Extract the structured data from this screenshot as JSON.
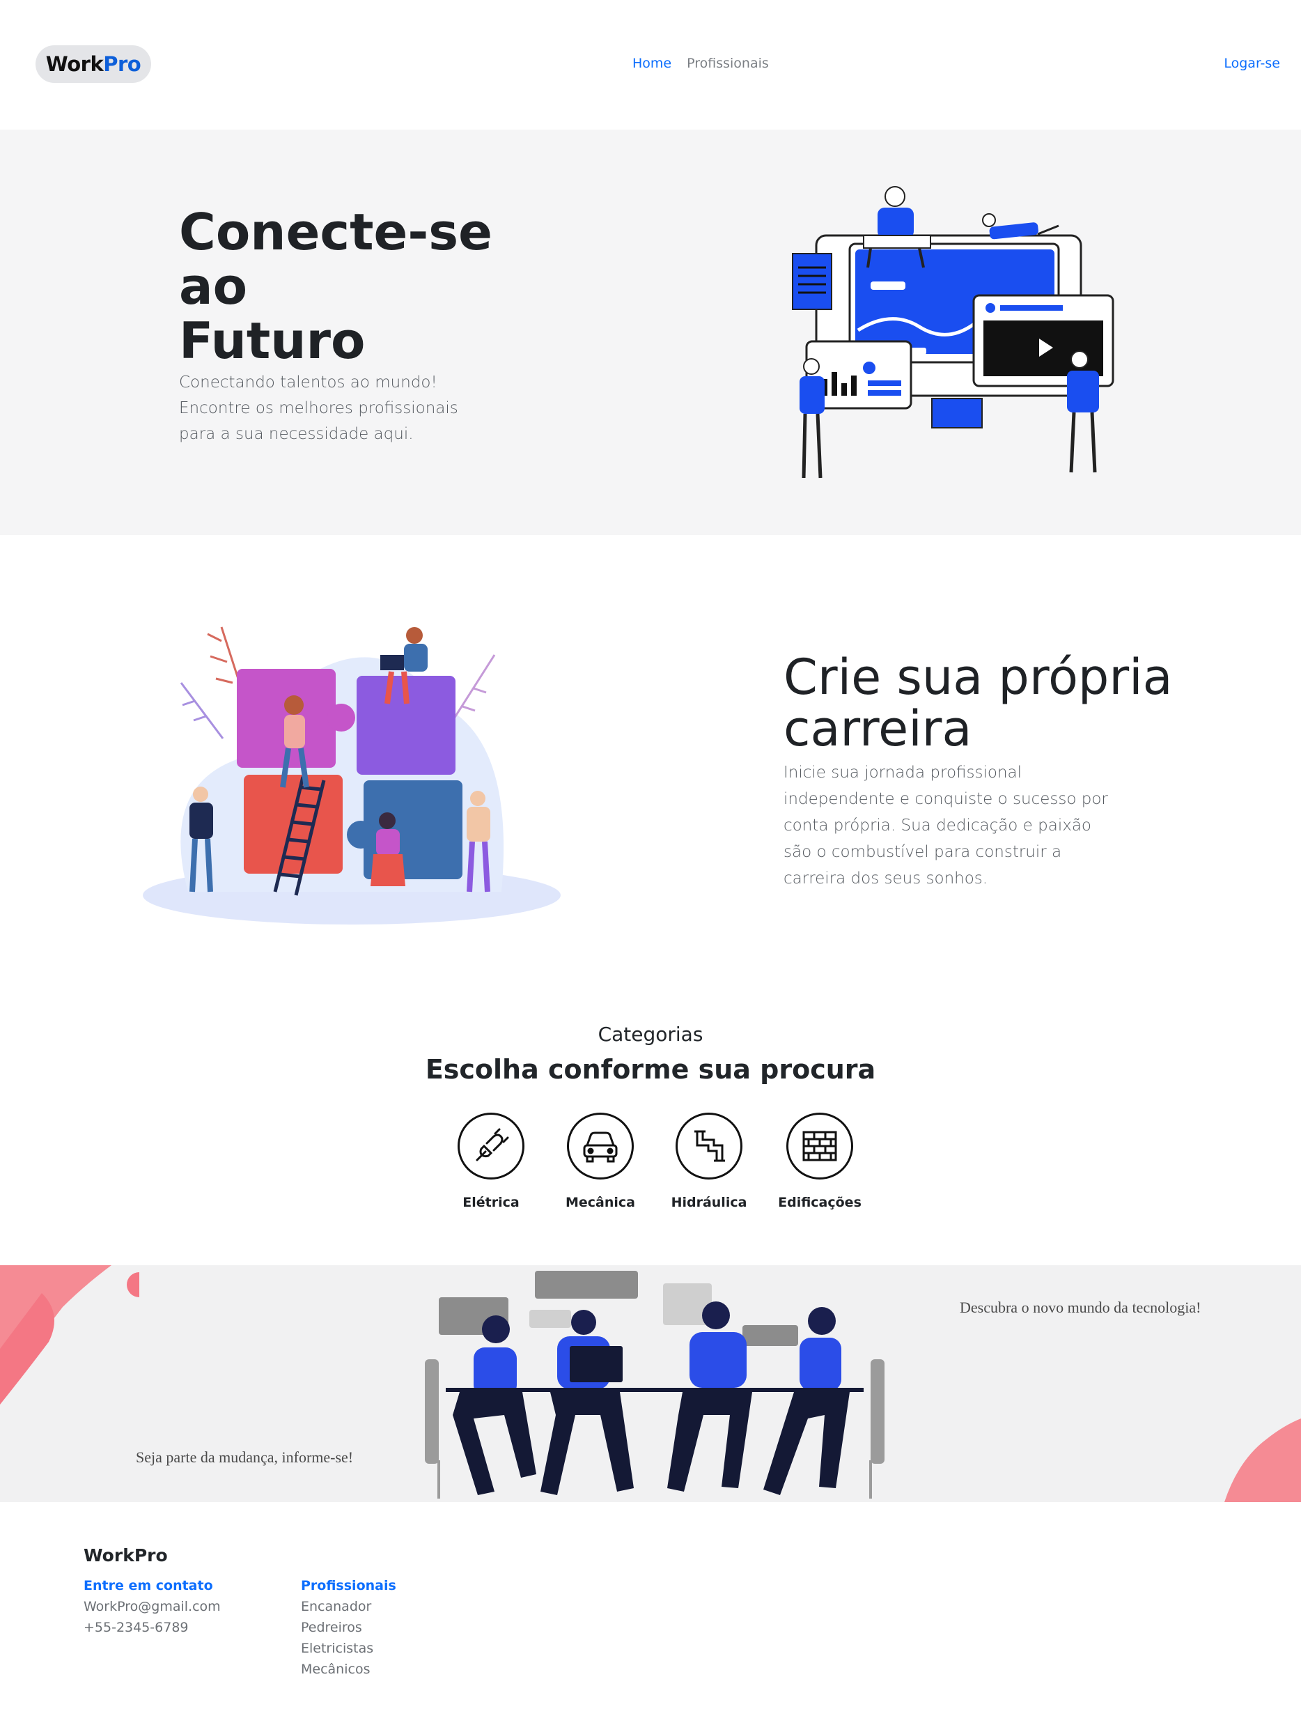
{
  "header": {
    "logo_work": "Work",
    "logo_pro": "Pro",
    "nav": [
      {
        "label": "Home"
      },
      {
        "label": "Profissionais"
      }
    ],
    "login": "Logar-se"
  },
  "hero": {
    "title_line1": "Conecte-se",
    "title_line2": "ao",
    "title_line3": "Futuro",
    "subtitle": "Conectando talentos ao mundo! Encontre os melhores profissionais para a sua necessidade aqui."
  },
  "career": {
    "title": "Crie sua própria carreira",
    "subtitle": "Inicie sua jornada profissional independente e conquiste o sucesso por conta própria. Sua dedicação e paixão são o combustível para construir a carreira dos seus sonhos."
  },
  "categories": {
    "kicker": "Categorias",
    "title": "Escolha conforme sua procura",
    "items": [
      {
        "label": "Elétrica",
        "icon": "plug-icon"
      },
      {
        "label": "Mecânica",
        "icon": "car-icon"
      },
      {
        "label": "Hidráulica",
        "icon": "pipe-icon"
      },
      {
        "label": "Edificações",
        "icon": "brick-wall-icon"
      }
    ]
  },
  "banner": {
    "left_text": "Seja parte da mudança, informe-se!",
    "right_text": "Descubra o novo mundo da tecnologia!"
  },
  "footer": {
    "brand": "WorkPro",
    "contact": {
      "heading": "Entre em contato",
      "email": "WorkPro@gmail.com",
      "phone": "+55-2345-6789"
    },
    "professionals": {
      "heading": "Profissionais",
      "items": [
        "Encanador",
        "Pedreiros",
        "Eletricistas",
        "Mecânicos"
      ]
    }
  },
  "colors": {
    "accent": "#0d6efd",
    "illustration_blue": "#1a4ef0",
    "hero_bg": "#f5f5f6",
    "banner_bg": "#f1f1f2"
  }
}
